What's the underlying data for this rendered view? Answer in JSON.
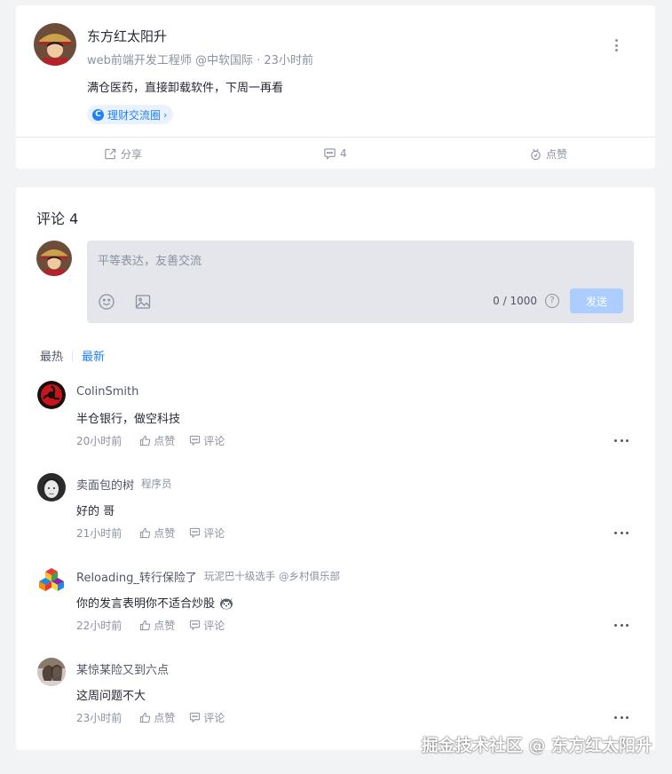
{
  "post": {
    "author": "东方红太阳升",
    "meta": "web前端开发工程师 @中软国际 · 23小时前",
    "content": "满仓医药，直接卸载软件，下周一再看",
    "topic": "理财交流圈",
    "topic_chevron": "›",
    "actions": {
      "share": "分享",
      "comment_count": "4",
      "like": "点赞"
    }
  },
  "comments_section": {
    "title": "评论 4",
    "input_placeholder": "平等表达，友善交流",
    "input_value": "",
    "char_count": "0 / 1000",
    "help_symbol": "?",
    "send_label": "发送",
    "sort_hot": "最热",
    "sort_new": "最新"
  },
  "comments": [
    {
      "author": "ColinSmith",
      "title": "",
      "text": "半仓银行，做空科技",
      "time": "20小时前",
      "like": "点赞",
      "reply": "评论",
      "avatar_icon": "sharingan-avatar"
    },
    {
      "author": "卖面包的树",
      "title": "程序员",
      "text": "好的 哥",
      "time": "21小时前",
      "like": "点赞",
      "reply": "评论",
      "avatar_icon": "sketch-portrait-avatar"
    },
    {
      "author": "Reloading_转行保险了",
      "title": "玩泥巴十级选手 @乡村俱乐部",
      "text": "你的发言表明你不适合炒股",
      "time": "22小时前",
      "like": "点赞",
      "reply": "评论",
      "avatar_icon": "lego-blocks-avatar",
      "emoji": "husky-emoji"
    },
    {
      "author": "某惊某险又到六点",
      "title": "",
      "text": "这周问题不大",
      "time": "23小时前",
      "like": "点赞",
      "reply": "评论",
      "avatar_icon": "photo-avatar"
    }
  ],
  "watermark": "掘金技术社区 @ 东方红太阳升",
  "colors": {
    "background": "#f2f3f5",
    "brand_blue": "#1e80ff",
    "send_disabled": "#abcdff",
    "input_bg": "#e4e6eb",
    "text_primary": "#252933",
    "text_secondary": "#8a919f"
  }
}
